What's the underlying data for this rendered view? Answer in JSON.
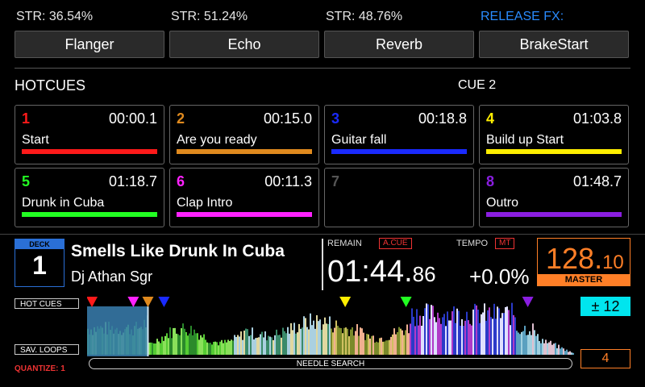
{
  "fx": [
    {
      "strength": "STR: 36.54%",
      "label": "Flanger"
    },
    {
      "strength": "STR: 51.24%",
      "label": "Echo"
    },
    {
      "strength": "STR: 48.76%",
      "label": "Reverb"
    },
    {
      "strength": "RELEASE FX:",
      "label": "BrakeStart"
    }
  ],
  "hotcues": {
    "title": "HOTCUES",
    "status": "CUE 2",
    "pads": [
      {
        "num": "1",
        "time": "00:00.1",
        "name": "Start",
        "color": "#ff1a1a"
      },
      {
        "num": "2",
        "time": "00:15.0",
        "name": "Are you ready",
        "color": "#e08a1e"
      },
      {
        "num": "3",
        "time": "00:18.8",
        "name": "Guitar fall",
        "color": "#1a2aff"
      },
      {
        "num": "4",
        "time": "01:03.8",
        "name": "Build up Start",
        "color": "#ffee00"
      },
      {
        "num": "5",
        "time": "01:18.7",
        "name": "Drunk in Cuba",
        "color": "#22ff22"
      },
      {
        "num": "6",
        "time": "00:11.3",
        "name": "Clap Intro",
        "color": "#ff22ff"
      },
      {
        "num": "7",
        "time": "",
        "name": "",
        "color": "#555555"
      },
      {
        "num": "8",
        "time": "01:48.7",
        "name": "Outro",
        "color": "#8a1ee0"
      }
    ]
  },
  "deck": {
    "label": "DECK",
    "number": "1",
    "title": "Smells Like Drunk In Cuba",
    "artist": "Dj Athan Sgr",
    "remain_label": "REMAIN",
    "acue_tag": "A.CUE",
    "time_main": "01:44.",
    "time_ms": "86",
    "tempo_label": "TEMPO",
    "tempo_tag": "MT",
    "tempo_value": "+0.0%",
    "bpm_int": "128.",
    "bpm_dec": "10",
    "master_label": "MASTER"
  },
  "waveform": {
    "hot_cues_btn": "HOT CUES",
    "sav_loops_btn": "SAV. LOOPS",
    "quantize": "QUANTIZE: 1",
    "needle_search": "NEEDLE SEARCH",
    "key": "± 12",
    "loop": "4",
    "markers": [
      {
        "position": 0.01,
        "color": "#ff1a1a"
      },
      {
        "position": 0.095,
        "color": "#ff22ff"
      },
      {
        "position": 0.125,
        "color": "#e08a1e"
      },
      {
        "position": 0.158,
        "color": "#1a2aff"
      },
      {
        "position": 0.53,
        "color": "#ffee00"
      },
      {
        "position": 0.655,
        "color": "#22ff22"
      },
      {
        "position": 0.905,
        "color": "#8a1ee0"
      }
    ],
    "played_fraction": 0.125
  }
}
